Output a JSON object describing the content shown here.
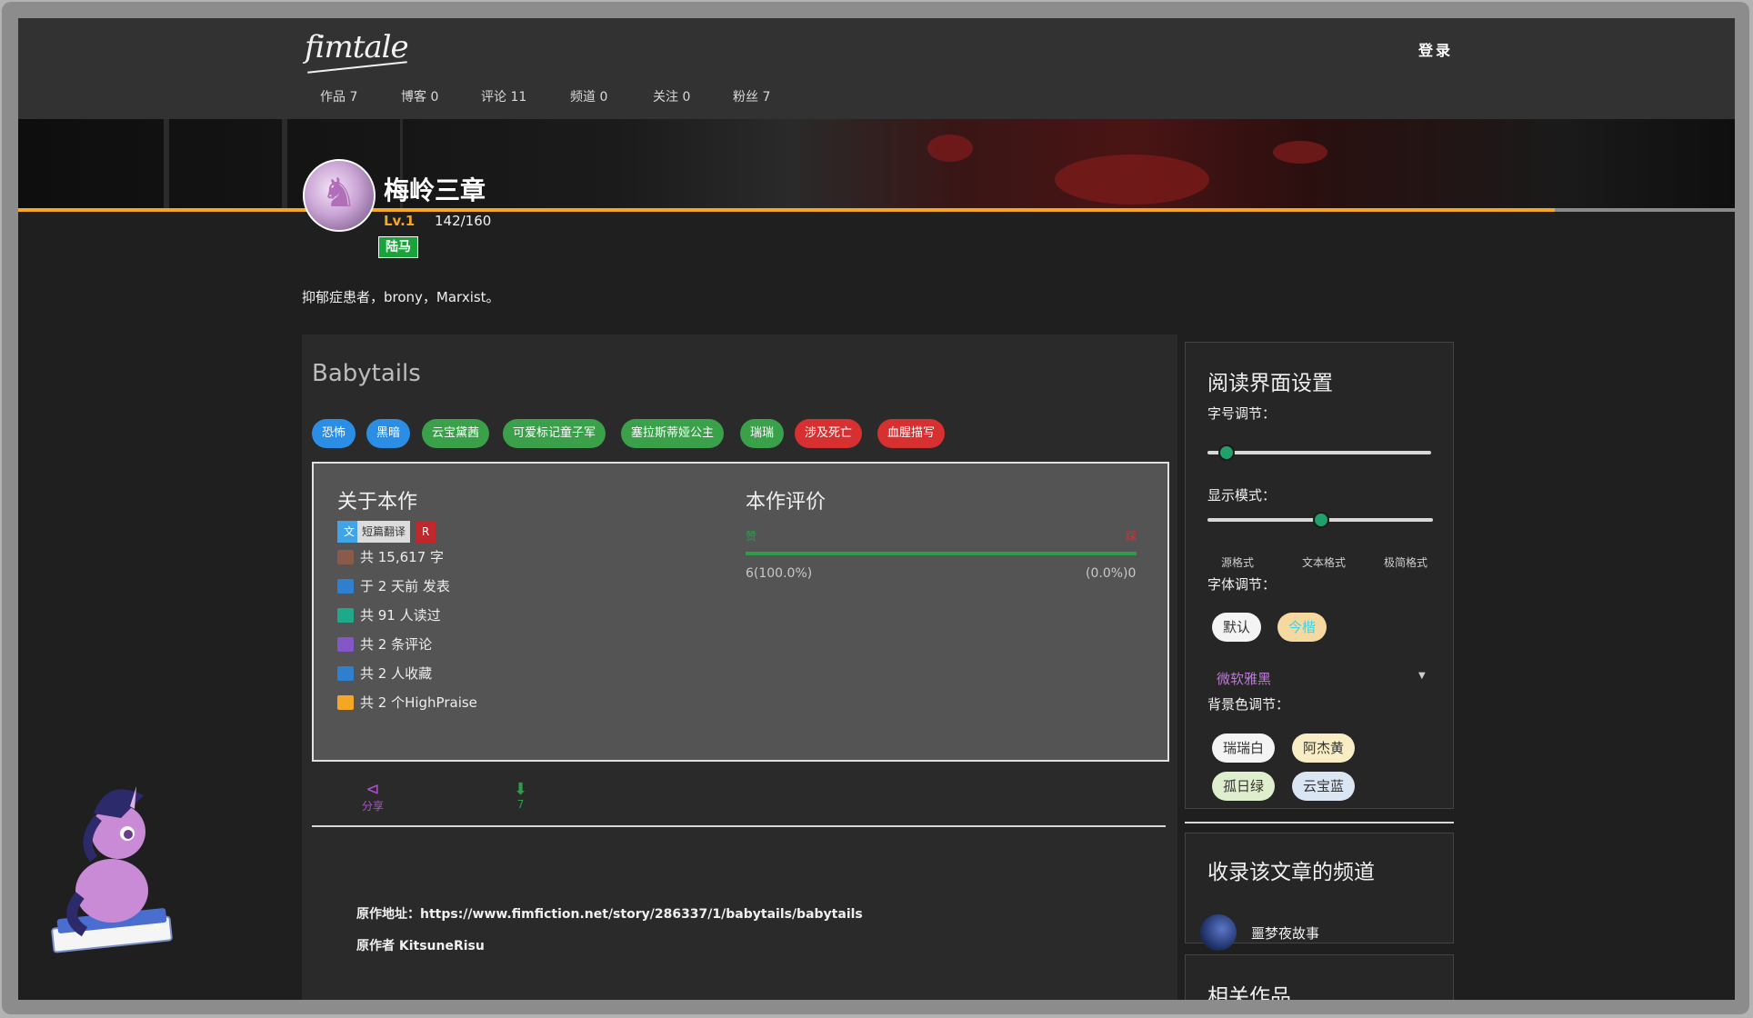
{
  "header": {
    "logo": "fimtale",
    "login": "登录",
    "tabs": [
      "作品 7",
      "博客 0",
      "评论 11",
      "频道 0",
      "关注 0",
      "粉丝 7"
    ]
  },
  "profile": {
    "name": "梅岭三章",
    "level": "Lv.1",
    "exp": "142/160",
    "rank": "陆马",
    "bio": "抑郁症患者，brony，Marxist。"
  },
  "story": {
    "title": "Babytails",
    "tags": [
      {
        "label": "恐怖",
        "color": "#2b8de4"
      },
      {
        "label": "黑暗",
        "color": "#2b8de4"
      },
      {
        "label": "云宝黛茜",
        "color": "#3aa04a"
      },
      {
        "label": "可爱标记童子军",
        "color": "#3aa04a"
      },
      {
        "label": "塞拉斯蒂娅公主",
        "color": "#3aa04a"
      },
      {
        "label": "瑞瑞",
        "color": "#3aa04a"
      },
      {
        "label": "涉及死亡",
        "color": "#d63031"
      },
      {
        "label": "血腥描写",
        "color": "#d63031"
      }
    ],
    "about_title": "关于本作",
    "categories": [
      {
        "label": "文",
        "color": "#41a4e8"
      },
      {
        "label": "短篇翻译",
        "color": "#dcdcdc"
      },
      {
        "label": "R",
        "color": "#c0282c"
      }
    ],
    "stats": [
      {
        "icon": "book-icon",
        "text": "共 15,617 字",
        "color": "#8b5a4a"
      },
      {
        "icon": "calendar-icon",
        "text": "于 2 天前 发表",
        "color": "#2f7fd1"
      },
      {
        "icon": "eye-icon",
        "text": "共 91 人读过",
        "color": "#1fa98b"
      },
      {
        "icon": "comment-icon",
        "text": "共 2 条评论",
        "color": "#8456c7"
      },
      {
        "icon": "bookmark-icon",
        "text": "共 2 人收藏",
        "color": "#2f7fd1"
      },
      {
        "icon": "star-icon",
        "text": "共 2 个HighPraise",
        "color": "#f5a623"
      }
    ],
    "rating_title": "本作评价",
    "rating": {
      "up_label": "赞",
      "down_label": "踩",
      "up_text": "6(100.0%)",
      "down_text": "(0.0%)0",
      "up_ratio": 1.0
    },
    "share_label": "分享",
    "download_count": "7",
    "source_url_label": "原作地址：https://www.fimfiction.net/story/286337/1/babytails/babytails",
    "source_author_label": "原作者 KitsuneRisu"
  },
  "settings": {
    "title": "阅读界面设置",
    "font_size_label": "字号调节：",
    "display_mode_label": "显示模式：",
    "modes": [
      "源格式",
      "文本格式",
      "极简格式"
    ],
    "font_label": "字体调节：",
    "fonts": [
      "默认",
      "今楷"
    ],
    "font_select": "微软雅黑",
    "bg_label": "背景色调节：",
    "bg_colors": [
      {
        "label": "瑞瑞白",
        "color": "#f4f4f4"
      },
      {
        "label": "阿杰黄",
        "color": "#f8edc5"
      },
      {
        "label": "孤日绿",
        "color": "#dfeecd"
      },
      {
        "label": "云宝蓝",
        "color": "#dbe6f5"
      }
    ]
  },
  "channels": {
    "title": "收录该文章的频道",
    "items": [
      "噩梦夜故事"
    ]
  },
  "related": {
    "title": "相关作品"
  }
}
